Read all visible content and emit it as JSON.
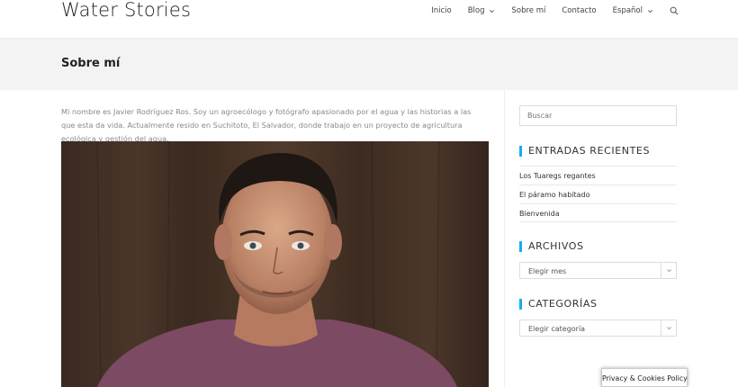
{
  "site": {
    "title": "Water Stories"
  },
  "nav": {
    "items": [
      {
        "label": "Inicio",
        "has_dropdown": false
      },
      {
        "label": "Blog",
        "has_dropdown": true
      },
      {
        "label": "Sobre mí",
        "has_dropdown": false
      },
      {
        "label": "Contacto",
        "has_dropdown": false
      },
      {
        "label": "Español",
        "has_dropdown": true
      }
    ],
    "search_icon": "search-icon"
  },
  "page": {
    "title": "Sobre mí",
    "intro": "Mi nombre es Javier Rodríguez Ros. Soy un agroecólogo y fotógrafo apasionado por el agua y las historias a las que esta da vida. Actualmente resido en Suchitoto, El Salvador, donde trabajo en un proyecto de agricultura ecológica y gestión del agua."
  },
  "sidebar": {
    "search_placeholder": "Buscar",
    "recent_title": "ENTRADAS RECIENTES",
    "recent_posts": [
      "Los Tuaregs regantes",
      "El páramo habitado",
      "Bienvenida"
    ],
    "archives_title": "ARCHIVOS",
    "archives_select": "Elegir mes",
    "categories_title": "CATEGORÍAS",
    "categories_select": "Elegir categoría"
  },
  "privacy": {
    "label": "Privacy & Cookies Policy"
  },
  "colors": {
    "accent": "#13aff0",
    "title_band": "#f3f3f3"
  }
}
